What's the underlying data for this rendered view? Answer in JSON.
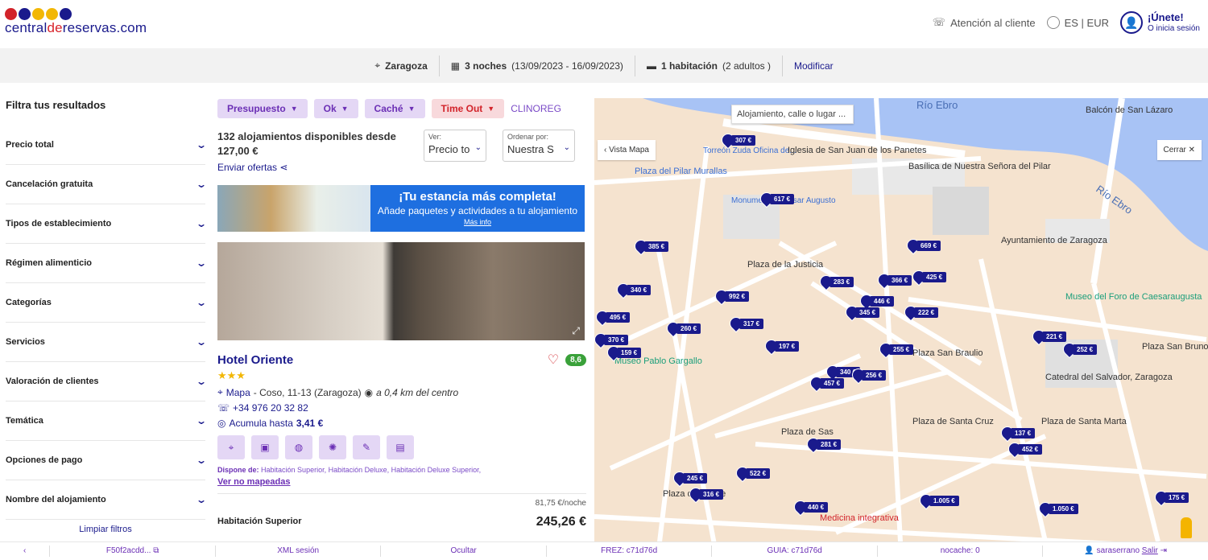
{
  "header": {
    "logo_pre": "central",
    "logo_de": "de",
    "logo_post": "reservas.com",
    "customer_service": "Atención al cliente",
    "lang_currency": "ES | EUR",
    "join": "¡Únete!",
    "login": "O inicia sesión"
  },
  "search": {
    "city": "Zaragoza",
    "nights": "3 noches",
    "dates": "(13/09/2023 - 16/09/2023)",
    "rooms": "1 habitación",
    "guests": "(2 adultos )",
    "modify": "Modificar"
  },
  "filters": {
    "title": "Filtra tus resultados",
    "items": [
      "Precio total",
      "Cancelación gratuita",
      "Tipos de establecimiento",
      "Régimen alimenticio",
      "Categorías",
      "Servicios",
      "Valoración de clientes",
      "Temática",
      "Opciones de pago",
      "Nombre del alojamiento"
    ],
    "clear": "Limpiar filtros"
  },
  "chips": {
    "presupuesto": "Presupuesto",
    "ok": "Ok",
    "cache": "Caché",
    "timeout": "Time Out",
    "clinoreg": "CLINOREG"
  },
  "summary": {
    "count": "132 alojamientos disponibles desde",
    "from_price": "127,00 €",
    "send": "Enviar ofertas",
    "view_label": "Ver:",
    "view_value": "Precio to",
    "order_label": "Ordenar por:",
    "order_value": "Nuestra S"
  },
  "banner": {
    "title": "¡Tu estancia más completa!",
    "subtitle": "Añade paquetes y actividades a tu alojamiento",
    "more": "Más info"
  },
  "hotel": {
    "name": "Hotel Oriente",
    "stars": "★★★",
    "score": "8,6",
    "map_link": "Mapa",
    "address": "- Coso, 11-13 (Zaragoza)",
    "distance": "a 0,4 km del centro",
    "phone": "+34 976 20 32 82",
    "accumulate": "Acumula hasta",
    "accumulate_value": "3,41 €",
    "dispone_label": "Dispone de:",
    "dispone_value": "Habitación Superior, Habitación Deluxe, Habitación Deluxe Superior,",
    "not_mapped": "Ver no mapeadas",
    "per_night": "81,75 €/noche",
    "room_name": "Habitación Superior",
    "price": "245,26 €"
  },
  "map": {
    "search_placeholder": "Alojamiento, calle o lugar ...",
    "vista": "‹ Vista Mapa",
    "cerrar": "Cerrar ✕",
    "labels": {
      "rio_ebro": "Río Ebro",
      "rio_ebro2": "Río Ebro",
      "balcon": "Balcón de San Lázaro",
      "basilica": "Basílica de Nuestra Señora del Pilar",
      "plaza_pilar": "Plaza del Pilar Murallas",
      "torreon": "Torreón Zuda Oficina de...",
      "iglesia": "Iglesia de San Juan de los Panetes",
      "monumento": "Monumento a César Augusto",
      "ayuntamiento": "Ayuntamiento de Zaragoza",
      "museo_foro": "Museo del Foro de Caesaraugusta",
      "plaza_justicia": "Plaza de la Justicia",
      "museo_gargallo": "Museo Pablo Gargallo",
      "plaza_braulio": "Plaza San Braulio",
      "catedral": "Catedral del Salvador, Zaragoza",
      "plaza_bruno": "Plaza San Bruno",
      "plaza_cruz": "Plaza de Santa Cruz",
      "plaza_marta": "Plaza de Santa Marta",
      "plaza_sas": "Plaza de Sas",
      "plaza_roque": "Plaza de Roque",
      "medicina": "Medicina integrativa"
    },
    "markers": [
      "307 €",
      "617 €",
      "385 €",
      "669 €",
      "283 €",
      "366 €",
      "425 €",
      "340 €",
      "992 €",
      "446 €",
      "222 €",
      "495 €",
      "260 €",
      "317 €",
      "345 €",
      "370 €",
      "159 €",
      "197 €",
      "255 €",
      "221 €",
      "252 €",
      "340 €",
      "256 €",
      "457 €",
      "137 €",
      "281 €",
      "452 €",
      "245 €",
      "522 €",
      "316 €",
      "440 €",
      "1.005 €",
      "1.050 €",
      "175 €"
    ]
  },
  "bottom": {
    "session_id": "F50f2acdd...",
    "xml": "XML sesión",
    "hide": "Ocultar",
    "frez": "FREZ: c71d76d",
    "guia": "GUIA: c71d76d",
    "nocache": "nocache: 0",
    "user": "saraserrano",
    "exit": "Salir"
  },
  "colors": {
    "brand_blue": "#1a1a8c",
    "accent_purple": "#6b2fb5",
    "timeout_red": "#d2232a",
    "banner_blue": "#1e6fe0",
    "score_green": "#3aa13a"
  }
}
